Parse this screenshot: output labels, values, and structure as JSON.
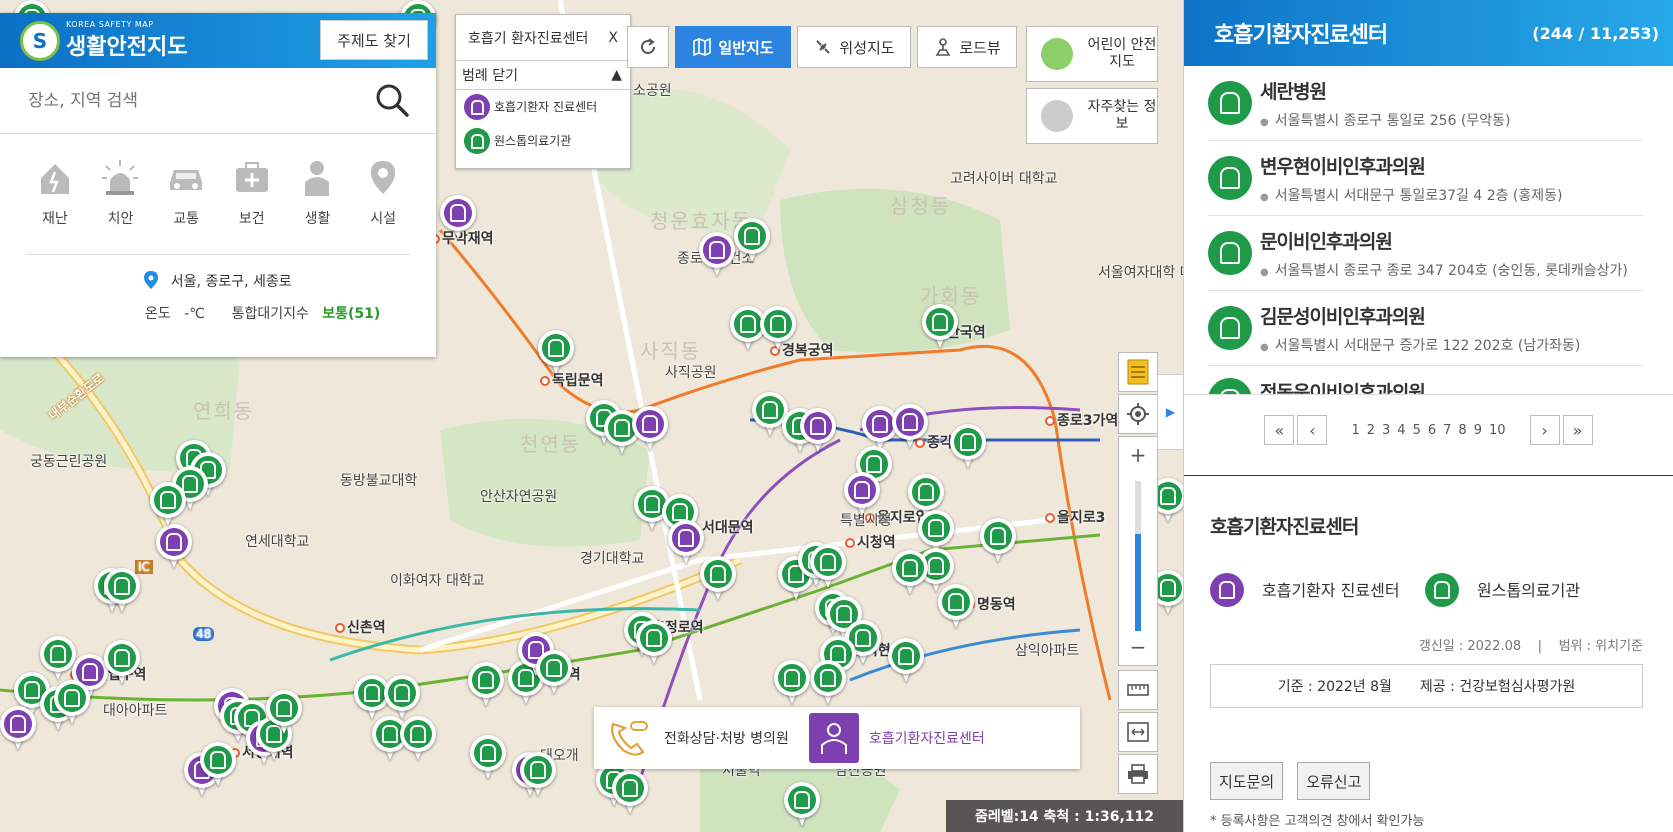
{
  "map": {
    "place_labels": [
      {
        "text": "무악재역",
        "kind": "station"
      },
      {
        "text": "독립문역",
        "kind": "station"
      },
      {
        "text": "경복궁역",
        "kind": "station"
      },
      {
        "text": "안국역",
        "kind": "station"
      },
      {
        "text": "종로3가역",
        "kind": "station"
      },
      {
        "text": "종각역",
        "kind": "station"
      },
      {
        "text": "서대문역",
        "kind": "station"
      },
      {
        "text": "시청역",
        "kind": "station"
      },
      {
        "text": "을지로입구",
        "kind": "station"
      },
      {
        "text": "을지로3",
        "kind": "station"
      },
      {
        "text": "명동역",
        "kind": "station"
      },
      {
        "text": "충정로역",
        "kind": "station"
      },
      {
        "text": "회현역",
        "kind": "station"
      },
      {
        "text": "아현역",
        "kind": "station"
      },
      {
        "text": "신촌역",
        "kind": "station"
      },
      {
        "text": "홍대입구역",
        "kind": "station"
      },
      {
        "text": "서강대역",
        "kind": "station"
      },
      {
        "text": "소공원",
        "kind": "place"
      },
      {
        "text": "종로구보건소",
        "kind": "place"
      },
      {
        "text": "고려사이버 대학교",
        "kind": "place"
      },
      {
        "text": "서울여자대학 대학로캠퍼",
        "kind": "place"
      },
      {
        "text": "사직공원",
        "kind": "place"
      },
      {
        "text": "궁동근린공원",
        "kind": "place"
      },
      {
        "text": "동방불교대학",
        "kind": "place"
      },
      {
        "text": "안산자연공원",
        "kind": "place"
      },
      {
        "text": "연세대학교",
        "kind": "place"
      },
      {
        "text": "이화여자 대학교",
        "kind": "place"
      },
      {
        "text": "경기대학교",
        "kind": "place"
      },
      {
        "text": "대아아파트",
        "kind": "place"
      },
      {
        "text": "삼익아파트",
        "kind": "place"
      },
      {
        "text": "특별시청",
        "kind": "place"
      },
      {
        "text": "대오개",
        "kind": "place"
      },
      {
        "text": "서울역",
        "kind": "place"
      },
      {
        "text": "남산공원",
        "kind": "place"
      },
      {
        "text": "내부순환도로",
        "kind": "road"
      },
      {
        "text": "48",
        "kind": "road"
      },
      {
        "text": "IC",
        "kind": "road"
      },
      {
        "text": "연희동",
        "kind": "district"
      },
      {
        "text": "천연동",
        "kind": "district"
      },
      {
        "text": "사직동",
        "kind": "district"
      },
      {
        "text": "삼청동",
        "kind": "district"
      },
      {
        "text": "가회동",
        "kind": "district"
      },
      {
        "text": "청운효자동",
        "kind": "district"
      }
    ]
  },
  "left_panel": {
    "logo_small": "KOREA SAFETY MAP",
    "logo_big": "생활안전지도",
    "theme_button": "주제도 찾기",
    "search_placeholder": "장소, 지역 검색",
    "categories": [
      {
        "label": "재난",
        "icon": "disaster-icon"
      },
      {
        "label": "치안",
        "icon": "police-siren-icon"
      },
      {
        "label": "교통",
        "icon": "car-icon"
      },
      {
        "label": "보건",
        "icon": "first-aid-kit-icon"
      },
      {
        "label": "생활",
        "icon": "person-icon"
      },
      {
        "label": "시설",
        "icon": "location-pin-icon"
      }
    ],
    "location": "서울, 종로구, 세종로",
    "temp_label": "온도",
    "temp_value": "-℃",
    "aqi_label": "통합대기지수",
    "aqi_value": "보통(51)"
  },
  "legend_popup": {
    "title": "호흡기 환자진료센터",
    "close_x": "X",
    "collapse_label": "범례 닫기",
    "collapse_arrow": "▲",
    "items": [
      {
        "label": "호흡기환자 진료센터",
        "color": "#7e3fb0"
      },
      {
        "label": "원스톱의료기관",
        "color": "#1e9a48"
      }
    ]
  },
  "toolbar": {
    "refresh_icon": "refresh-icon",
    "general_map": "일반지도",
    "satellite_map": "위성지도",
    "roadview": "로드뷰",
    "child_safety_map": "어린이 안전지도",
    "faq_info": "자주찾는 정보"
  },
  "map_tools": {
    "zoom_in": "+",
    "zoom_out": "−",
    "zoom_level_fraction": 0.65
  },
  "bottom_tabs": [
    {
      "label": "전화상담·처방 병의원",
      "active": false
    },
    {
      "label": "호흡기환자진료센터",
      "active": true
    }
  ],
  "scale_bar": "줌레벨:14 축척 : 1:36,112",
  "right_panel": {
    "title": "호흡기환자진료센터",
    "count": "(244 / 11,253)",
    "hospitals": [
      {
        "name": "세란병원",
        "address": "서울특별시 종로구 통일로 256 (무악동)"
      },
      {
        "name": "변우현이비인후과의원",
        "address": "서울특별시 서대문구 통일로37길 4 2층 (홍제동)"
      },
      {
        "name": "문이비인후과의원",
        "address": "서울특별시 종로구 종로 347 204호 (숭인동, 롯데캐슬상가)"
      },
      {
        "name": "김문성이비인후과의원",
        "address": "서울특별시 서대문구 증가로 122 202호 (남가좌동)"
      },
      {
        "name": "정동욱이비인후과의원",
        "address": ""
      }
    ],
    "pager": {
      "first": "«",
      "prev": "‹",
      "next": "›",
      "last": "»",
      "pages": [
        "1",
        "2",
        "3",
        "4",
        "5",
        "6",
        "7",
        "8",
        "9",
        "10"
      ]
    },
    "section_title": "호흡기환자진료센터",
    "legend": [
      {
        "label": "호흡기환자 진료센터",
        "color": "#7e3fb0"
      },
      {
        "label": "원스톱의료기관",
        "color": "#1e9a48"
      }
    ],
    "updated": "갱신일 : 2022.08",
    "separator": "|",
    "range": "범위 : 위치기준",
    "basis": "기준 : 2022년 8월",
    "provider": "제공 : 건강보험심사평가원",
    "inquiry_button": "지도문의",
    "report_button": "오류신고",
    "note": "* 등록사항은 고객의견 창에서 확인가능"
  },
  "colors": {
    "header_blue": "#0e73c7",
    "active_blue": "#2b84e0",
    "purple_center": "#7e3fb0",
    "green_onestop": "#1e9a48"
  }
}
